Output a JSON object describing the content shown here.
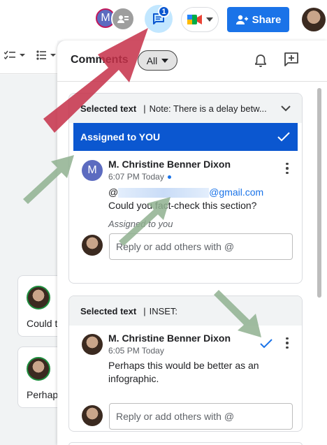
{
  "topbar": {
    "avatar_letter": "M",
    "comments_badge": "1",
    "share_label": "Share"
  },
  "doc_cards": [
    {
      "text": "Could t"
    },
    {
      "text": "Perhap"
    }
  ],
  "panel": {
    "title": "Comments",
    "filter_value": "All"
  },
  "threads": [
    {
      "header_label": "Selected text",
      "header_quote": "Note: There is a delay betw...",
      "assigned_banner": "Assigned to YOU",
      "comment": {
        "avatar_letter": "M",
        "author": "M. Christine Benner Dixon",
        "time": "6:07 PM Today",
        "body_prefix": "@",
        "email_visible": "@gmail.com",
        "body_suffix": " Could you fact-check this section?",
        "assigned_note": "Assigned to you"
      },
      "reply_placeholder": "Reply or add others with @"
    },
    {
      "header_label": "Selected text",
      "header_quote": "INSET:",
      "comment": {
        "author": "M. Christine Benner Dixon",
        "time": "6:05 PM Today",
        "body": "Perhaps this would be better as an infographic."
      },
      "reply_placeholder": "Reply or add others with @"
    }
  ],
  "colors": {
    "accent_blue": "#0b57d0",
    "share_blue": "#1a73e8",
    "annotation_red": "#c62f48",
    "annotation_green": "#8fb08f"
  },
  "icons": [
    "anonymous-user-icon",
    "comment-icon",
    "google-meet-icon",
    "share-person-icon",
    "checklist-icon",
    "bulleted-list-icon",
    "bell-icon",
    "add-comment-icon",
    "chevron-down-icon",
    "checkmark-icon",
    "more-vert-icon",
    "resolve-check-icon"
  ]
}
